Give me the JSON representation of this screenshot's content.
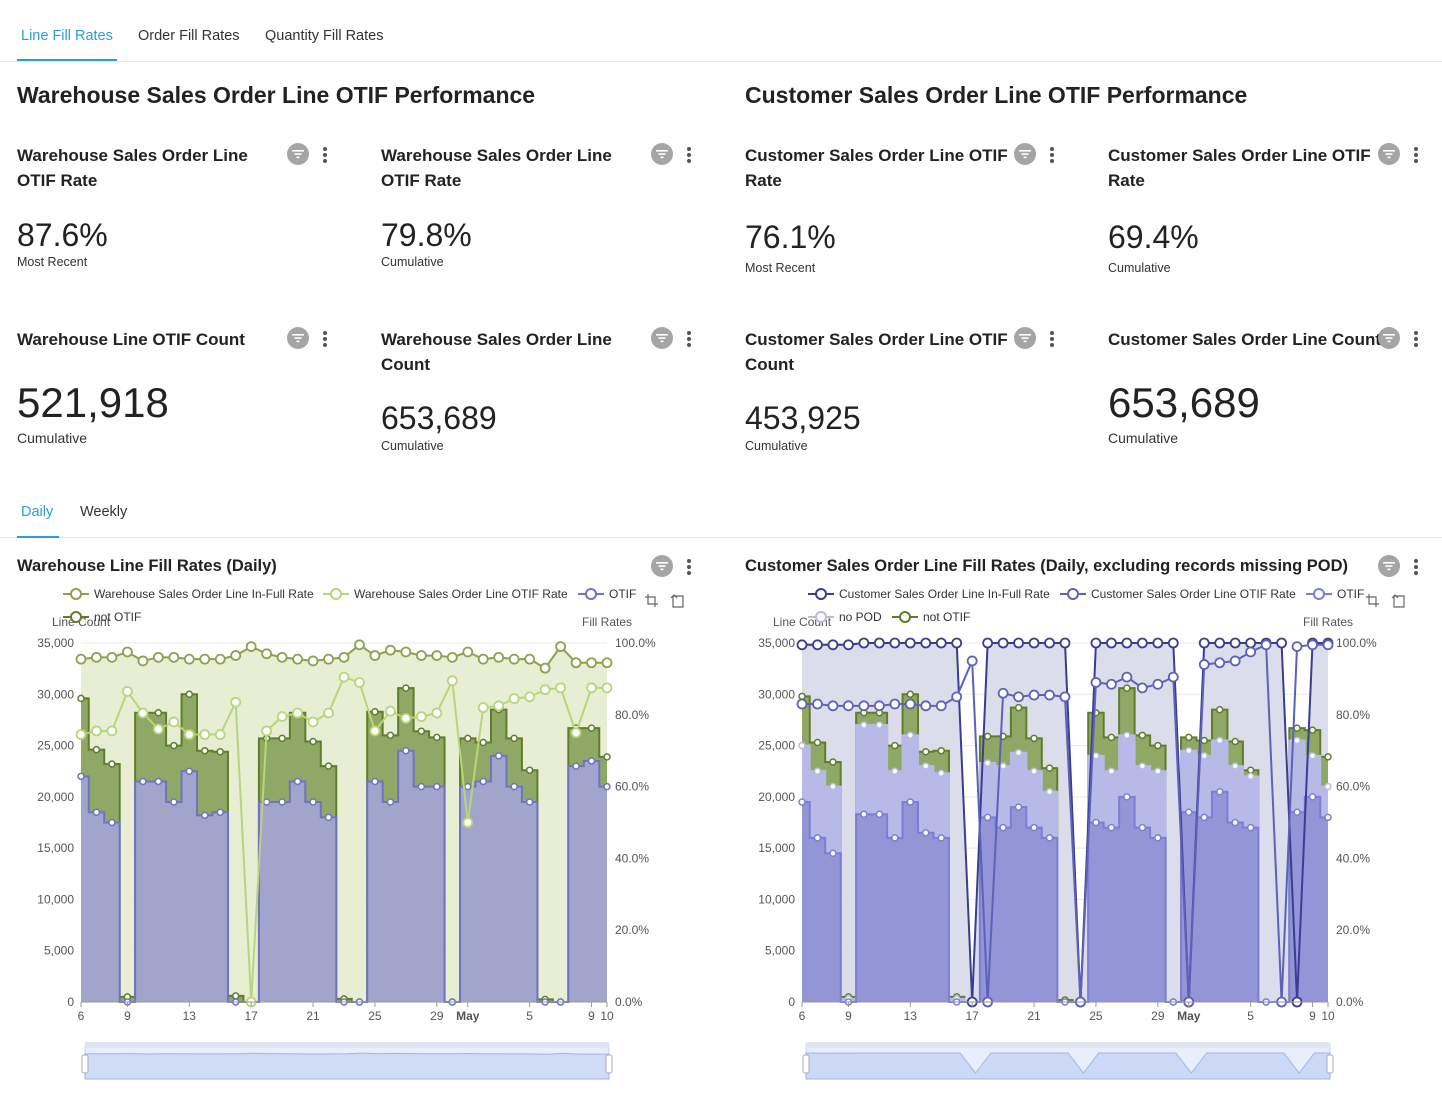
{
  "top_tabs": [
    {
      "label": "Line Fill Rates",
      "active": true
    },
    {
      "label": "Order Fill Rates",
      "active": false
    },
    {
      "label": "Quantity Fill Rates",
      "active": false
    }
  ],
  "warehouse_section": {
    "title": "Warehouse Sales Order Line OTIF Performance",
    "kpis": [
      {
        "title": "Warehouse Sales Order Line OTIF Rate",
        "value": "87.6%",
        "sub": "Most Recent"
      },
      {
        "title": "Warehouse Sales Order Line OTIF Rate",
        "value": "79.8%",
        "sub": "Cumulative"
      },
      {
        "title": "Warehouse Line OTIF Count",
        "value": "521,918",
        "sub": "Cumulative"
      },
      {
        "title": "Warehouse Sales Order Line Count",
        "value": "653,689",
        "sub": "Cumulative"
      }
    ]
  },
  "customer_section": {
    "title": "Customer Sales Order Line OTIF Performance",
    "kpis": [
      {
        "title": "Customer Sales Order Line OTIF Rate",
        "value": "76.1%",
        "sub": "Most Recent"
      },
      {
        "title": "Customer Sales Order Line OTIF Rate",
        "value": "69.4%",
        "sub": "Cumulative"
      },
      {
        "title": "Customer Sales Order Line OTIF Count",
        "value": "453,925",
        "sub": "Cumulative"
      },
      {
        "title": "Customer Sales Order Line Count",
        "value": "653,689",
        "sub": "Cumulative"
      }
    ]
  },
  "period_tabs": [
    {
      "label": "Daily",
      "active": true
    },
    {
      "label": "Weekly",
      "active": false
    }
  ],
  "icons": {
    "filter": "filter-icon",
    "more": "kebab-menu-icon",
    "zoom": "data-zoom-icon",
    "reset": "zoom-reset-icon"
  },
  "colors": {
    "accent": "#2a9fd6",
    "wh_otif": "#6f72c5",
    "wh_otif_fill": "#a1a5cc",
    "wh_notif": "#5f7d2a",
    "wh_notif_fill": "#8fa865",
    "wh_rate_infull": "#8fa04c",
    "wh_rate_otif": "#b9d57a",
    "wh_rate_fill": "#e3ebcc",
    "cu_otif": "#7a7ed6",
    "cu_otif_fill": "#9395d6",
    "cu_nopod_fill": "#b7bae6",
    "cu_notif": "#5f7d2a",
    "cu_notif_fill": "#8fa865",
    "cu_rate_infull": "#3a3d90",
    "cu_rate_otif": "#5d62b8",
    "cu_rate_fill": "#d6d7e8"
  },
  "chart_data": [
    {
      "type": "area",
      "title": "Warehouse Line Fill Rates (Daily)",
      "ylabel_left": "Line Count",
      "ylabel_right": "Fill Rates",
      "y_left_ticks": [
        "35,000",
        "30,000",
        "25,000",
        "20,000",
        "15,000",
        "10,000",
        "5,000",
        "0"
      ],
      "y_right_ticks": [
        "100.0%",
        "80.0%",
        "60.0%",
        "40.0%",
        "20.0%",
        "0.0%"
      ],
      "ylim_left": [
        0,
        35000
      ],
      "ylim_right": [
        0,
        100
      ],
      "x_ticks": [
        {
          "label": "6",
          "day": 0,
          "bold": false
        },
        {
          "label": "9",
          "day": 3,
          "bold": false
        },
        {
          "label": "13",
          "day": 7,
          "bold": false
        },
        {
          "label": "17",
          "day": 11,
          "bold": false
        },
        {
          "label": "21",
          "day": 15,
          "bold": false
        },
        {
          "label": "25",
          "day": 19,
          "bold": false
        },
        {
          "label": "29",
          "day": 23,
          "bold": false
        },
        {
          "label": "May",
          "day": 25,
          "bold": true
        },
        {
          "label": "5",
          "day": 29,
          "bold": false
        },
        {
          "label": "9",
          "day": 33,
          "bold": false
        },
        {
          "label": "10",
          "day": 34,
          "bold": false
        }
      ],
      "legend": [
        "Warehouse Sales Order Line In-Full Rate",
        "Warehouse Sales Order Line OTIF Rate",
        "OTIF",
        "not OTIF"
      ],
      "x": [
        0,
        1,
        2,
        3,
        4,
        5,
        6,
        7,
        8,
        9,
        10,
        11,
        12,
        13,
        14,
        15,
        16,
        17,
        18,
        19,
        20,
        21,
        22,
        23,
        24,
        25,
        26,
        27,
        28,
        29,
        30,
        31,
        32,
        33,
        34
      ],
      "series": [
        {
          "name": "OTIF",
          "axis": "left",
          "values": [
            22000,
            18500,
            17500,
            0,
            21500,
            21500,
            19500,
            22500,
            18200,
            18500,
            0,
            0,
            19500,
            19500,
            21500,
            19500,
            18000,
            0,
            0,
            21500,
            19500,
            24500,
            21000,
            21000,
            0,
            21000,
            21500,
            24000,
            21000,
            19500,
            0,
            0,
            23000,
            23500,
            21000
          ]
        },
        {
          "name": "not OTIF",
          "axis": "left",
          "values": [
            29600,
            24600,
            23200,
            500,
            28200,
            28200,
            25000,
            30000,
            24500,
            24400,
            600,
            0,
            25700,
            25700,
            28200,
            25400,
            23000,
            300,
            0,
            28300,
            26000,
            30600,
            26400,
            25800,
            0,
            25700,
            25300,
            28500,
            25700,
            22600,
            250,
            0,
            26700,
            26700,
            23900
          ]
        },
        {
          "name": "Warehouse Sales Order Line In-Full Rate",
          "axis": "right",
          "values": [
            95.5,
            96.0,
            96.0,
            97.5,
            95.0,
            96.0,
            96.0,
            95.5,
            95.5,
            95.5,
            96.5,
            99.0,
            97.0,
            96.0,
            95.5,
            95.0,
            95.5,
            96.0,
            99.5,
            96.5,
            98.0,
            97.5,
            96.5,
            96.5,
            96.0,
            97.5,
            95.5,
            96.0,
            95.5,
            95.5,
            93.0,
            99.0,
            94.5,
            94.5,
            94.5
          ]
        },
        {
          "name": "Warehouse Sales Order Line OTIF Rate",
          "axis": "right",
          "values": [
            74.5,
            75.5,
            75.5,
            86.5,
            80.5,
            76.0,
            78.0,
            74.5,
            74.5,
            74.5,
            83.5,
            0.0,
            75.5,
            79.5,
            80.5,
            78.0,
            80.5,
            90.5,
            89.0,
            75.5,
            81.0,
            79.0,
            79.5,
            80.5,
            89.5,
            50.0,
            82.0,
            82.5,
            84.5,
            85.0,
            87.0,
            87.5,
            75.0,
            87.5,
            87.5
          ]
        }
      ]
    },
    {
      "type": "area",
      "title": "Customer Sales Order Line Fill Rates (Daily, excluding records missing POD)",
      "ylabel_left": "Line Count",
      "ylabel_right": "Fill Rates",
      "y_left_ticks": [
        "35,000",
        "30,000",
        "25,000",
        "20,000",
        "15,000",
        "10,000",
        "5,000",
        "0"
      ],
      "y_right_ticks": [
        "100.0%",
        "80.0%",
        "60.0%",
        "40.0%",
        "20.0%",
        "0.0%"
      ],
      "ylim_left": [
        0,
        35000
      ],
      "ylim_right": [
        0,
        100
      ],
      "x_ticks": [
        {
          "label": "6",
          "day": 0,
          "bold": false
        },
        {
          "label": "9",
          "day": 3,
          "bold": false
        },
        {
          "label": "13",
          "day": 7,
          "bold": false
        },
        {
          "label": "17",
          "day": 11,
          "bold": false
        },
        {
          "label": "21",
          "day": 15,
          "bold": false
        },
        {
          "label": "25",
          "day": 19,
          "bold": false
        },
        {
          "label": "29",
          "day": 23,
          "bold": false
        },
        {
          "label": "May",
          "day": 25,
          "bold": true
        },
        {
          "label": "5",
          "day": 29,
          "bold": false
        },
        {
          "label": "9",
          "day": 33,
          "bold": false
        },
        {
          "label": "10",
          "day": 34,
          "bold": false
        }
      ],
      "legend": [
        "Customer Sales Order Line In-Full Rate",
        "Customer Sales Order Line OTIF Rate",
        "OTIF",
        "no POD",
        "not OTIF"
      ],
      "x": [
        0,
        1,
        2,
        3,
        4,
        5,
        6,
        7,
        8,
        9,
        10,
        11,
        12,
        13,
        14,
        15,
        16,
        17,
        18,
        19,
        20,
        21,
        22,
        23,
        24,
        25,
        26,
        27,
        28,
        29,
        30,
        31,
        32,
        33,
        34
      ],
      "series": [
        {
          "name": "OTIF",
          "axis": "left",
          "values": [
            19500,
            16000,
            14500,
            0,
            18300,
            18300,
            16000,
            19500,
            16500,
            16000,
            0,
            0,
            18000,
            17000,
            19000,
            17000,
            16000,
            0,
            0,
            17500,
            17000,
            20000,
            17000,
            16000,
            0,
            18500,
            18000,
            20500,
            17500,
            17000,
            0,
            0,
            18500,
            20000,
            18000
          ]
        },
        {
          "name": "no POD",
          "axis": "left",
          "values": [
            25000,
            22500,
            21000,
            300,
            27000,
            27000,
            22500,
            26000,
            23000,
            22300,
            300,
            0,
            23300,
            23000,
            24300,
            22500,
            20500,
            0,
            0,
            24000,
            22500,
            26000,
            23000,
            22500,
            0,
            24500,
            24000,
            25500,
            23000,
            22000,
            0,
            0,
            25500,
            24000,
            21000
          ]
        },
        {
          "name": "not OTIF",
          "axis": "left",
          "values": [
            29800,
            25300,
            23400,
            500,
            28200,
            28200,
            25000,
            30000,
            24400,
            24500,
            500,
            0,
            25900,
            25900,
            28700,
            25700,
            22800,
            200,
            0,
            28200,
            25800,
            30600,
            26000,
            25000,
            0,
            25800,
            25500,
            28500,
            25400,
            22600,
            0,
            0,
            26700,
            26500,
            23900
          ]
        },
        {
          "name": "Customer Sales Order Line In-Full Rate",
          "axis": "right",
          "values": [
            99.5,
            99.5,
            99.5,
            99.5,
            100.0,
            100.0,
            100.0,
            100.0,
            100.0,
            100.0,
            100.0,
            0.0,
            100.0,
            100.0,
            100.0,
            100.0,
            100.0,
            100.0,
            0.0,
            100.0,
            100.0,
            100.0,
            100.0,
            100.0,
            100.0,
            0.0,
            100.0,
            100.0,
            100.0,
            100.0,
            100.0,
            100.0,
            0.0,
            100.0,
            100.0
          ]
        },
        {
          "name": "Customer Sales Order Line OTIF Rate",
          "axis": "right",
          "values": [
            83.0,
            83.0,
            82.5,
            82.5,
            82.5,
            82.5,
            83.0,
            83.0,
            82.5,
            82.5,
            85.0,
            95.0,
            0.0,
            86.0,
            85.0,
            85.5,
            85.5,
            85.0,
            0.0,
            89.0,
            88.5,
            90.5,
            87.5,
            88.5,
            90.5,
            0.0,
            94.0,
            94.5,
            95.0,
            97.5,
            99.5,
            0.0,
            99.0,
            99.5,
            99.5
          ]
        }
      ]
    }
  ]
}
